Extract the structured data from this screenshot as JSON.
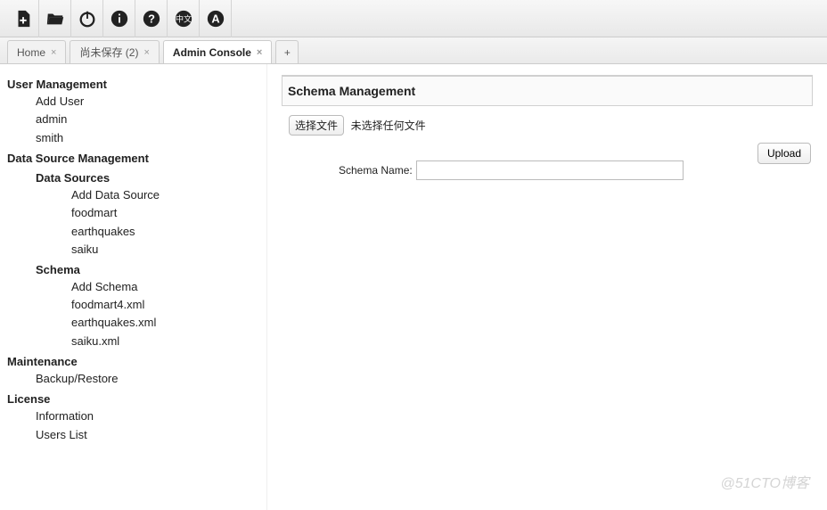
{
  "toolbar": {
    "new_icon": "new-file-icon",
    "open_icon": "folder-open-icon",
    "refresh_icon": "power-icon",
    "info_icon": "info-icon",
    "help_icon": "help-icon",
    "lang_icon": "language-icon",
    "admin_icon": "admin-icon"
  },
  "tabs": [
    {
      "label": "Home",
      "active": false
    },
    {
      "label": "尚未保存 (2)",
      "active": false
    },
    {
      "label": "Admin Console",
      "active": true
    }
  ],
  "sidebar": {
    "user_management": {
      "title": "User Management",
      "items": [
        "Add User",
        "admin",
        "smith"
      ]
    },
    "data_source_management": {
      "title": "Data Source Management",
      "data_sources": {
        "title": "Data Sources",
        "items": [
          "Add Data Source",
          "foodmart",
          "earthquakes",
          "saiku"
        ]
      },
      "schema": {
        "title": "Schema",
        "items": [
          "Add Schema",
          "foodmart4.xml",
          "earthquakes.xml",
          "saiku.xml"
        ]
      }
    },
    "maintenance": {
      "title": "Maintenance",
      "items": [
        "Backup/Restore"
      ]
    },
    "license": {
      "title": "License",
      "items": [
        "Information",
        "Users List"
      ]
    }
  },
  "panel": {
    "title": "Schema Management",
    "choose_file_label": "选择文件",
    "no_file_text": "未选择任何文件",
    "schema_name_label": "Schema Name:",
    "schema_name_value": "",
    "upload_label": "Upload"
  },
  "watermark": "@51CTO博客"
}
